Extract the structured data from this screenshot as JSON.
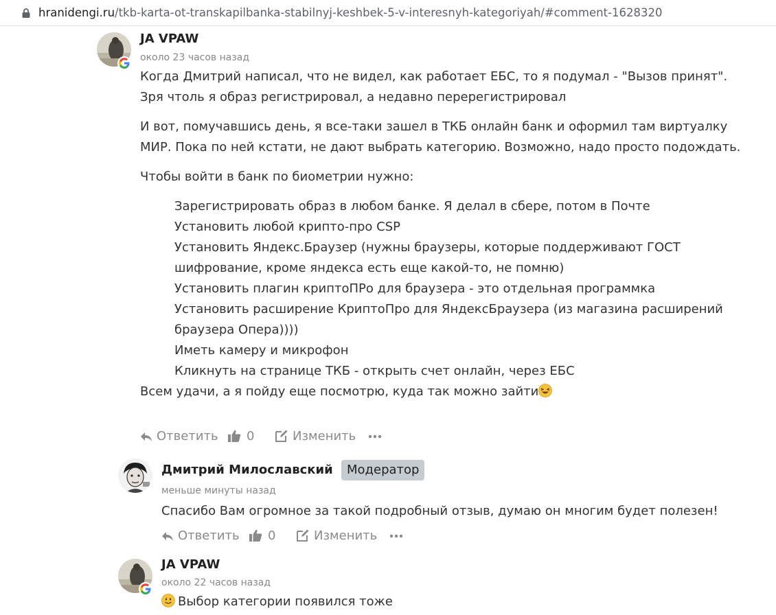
{
  "browser": {
    "url_host": "hranidengi.ru",
    "url_path": "/tkb-karta-ot-transkapilbanka-stabilnyj-keshbek-5-v-interesnyh-kategoriyah/#comment-1628320"
  },
  "comments": [
    {
      "author": "JA VPAW",
      "time": "около 23 часов назад",
      "paragraphs": [
        "Когда Дмитрий написал, что не видел, как работает ЕБС, то я подумал - \"Вызов принят\". Зря чтоль я образ регистрировал, а недавно перерегистрировал",
        "И вот, помучавшись день, я все-таки зашел в ТКБ онлайн банк и оформил там виртуалку МИР. Пока по ней кстати, не дают выбрать категорию. Возможно, надо просто подождать.",
        "Чтобы войти в банк по биометрии нужно:"
      ],
      "list": [
        "Зарегистрировать образ в любом банке. Я делал в сбере, потом в Почте",
        "Установить любой крипто-про CSP",
        "Установить Яндекс.Браузер (нужны браузеры, которые поддерживают ГОСТ шифрование, кроме яндекса есть еще какой-то, не помню)",
        "Установить плагин криптоПРо для браузера - это отдельная программка",
        "Установить расширение КриптоПро для ЯндексБраузера (из магазина расширений браузера Опера))))",
        "Иметь камеру и микрофон",
        "Кликнуть на странице ТКБ - открыть счет онлайн, через ЕБС"
      ],
      "closing": "Всем удачи, а я пойду еще посмотрю, куда так можно зайти",
      "actions": {
        "reply": "Ответить",
        "likes": "0",
        "edit": "Изменить"
      }
    },
    {
      "author": "Дмитрий Милославский",
      "badge": "Модератор",
      "time": "меньше минуты назад",
      "text": "Спасибо Вам огромное за такой подробный отзыв, думаю он многим будет полезен!",
      "actions": {
        "reply": "Ответить",
        "likes": "0",
        "edit": "Изменить"
      }
    },
    {
      "author": "JA VPAW",
      "time": "около 22 часов назад",
      "text": "Выбор категории появился тоже"
    }
  ],
  "icons": {
    "lock": "lock-icon",
    "google": "google-icon",
    "reply": "reply-icon",
    "like": "thumbs-up-icon",
    "edit": "edit-icon",
    "more": "more-icon",
    "laugh": "laughing-emoji-icon",
    "smile": "smiling-emoji-icon"
  },
  "colors": {
    "action_text": "#8a8a8a",
    "badge_bg": "#c7ccd1",
    "meta_text": "#888888",
    "body_text": "#333333"
  }
}
